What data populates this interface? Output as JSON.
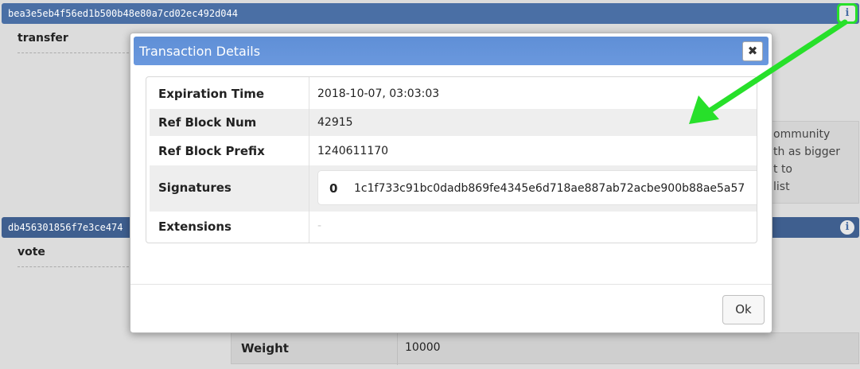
{
  "transactions": [
    {
      "hash": "bea3e5eb4f56ed1b500b48e80a7cd02ec492d044",
      "operation": "transfer"
    },
    {
      "hash": "db456301856f7e3ce474",
      "operation": "vote"
    }
  ],
  "background": {
    "proposal_text_lines": [
      "ommunity",
      "th as bigger",
      "t to",
      "list"
    ],
    "weight_label": "Weight",
    "weight_value": "10000"
  },
  "modal": {
    "title": "Transaction Details",
    "close_label": "✖",
    "fields": {
      "expiration_label": "Expiration Time",
      "expiration_value": "2018-10-07, 03:03:03",
      "ref_block_num_label": "Ref Block Num",
      "ref_block_num_value": "42915",
      "ref_block_prefix_label": "Ref Block Prefix",
      "ref_block_prefix_value": "1240611170",
      "signatures_label": "Signatures",
      "signature_index": "0",
      "signature_value": "1c1f733c91bc0dadb869fe4345e6d718ae887ab72acbe900b88ae5a57",
      "extensions_label": "Extensions",
      "extensions_value": "-"
    },
    "ok_label": "Ok"
  },
  "icons": {
    "info": "info-icon",
    "close": "close-icon"
  },
  "colors": {
    "header": "#4a6fa5",
    "modal_header": "#6a98de",
    "highlight": "#27e02a"
  }
}
